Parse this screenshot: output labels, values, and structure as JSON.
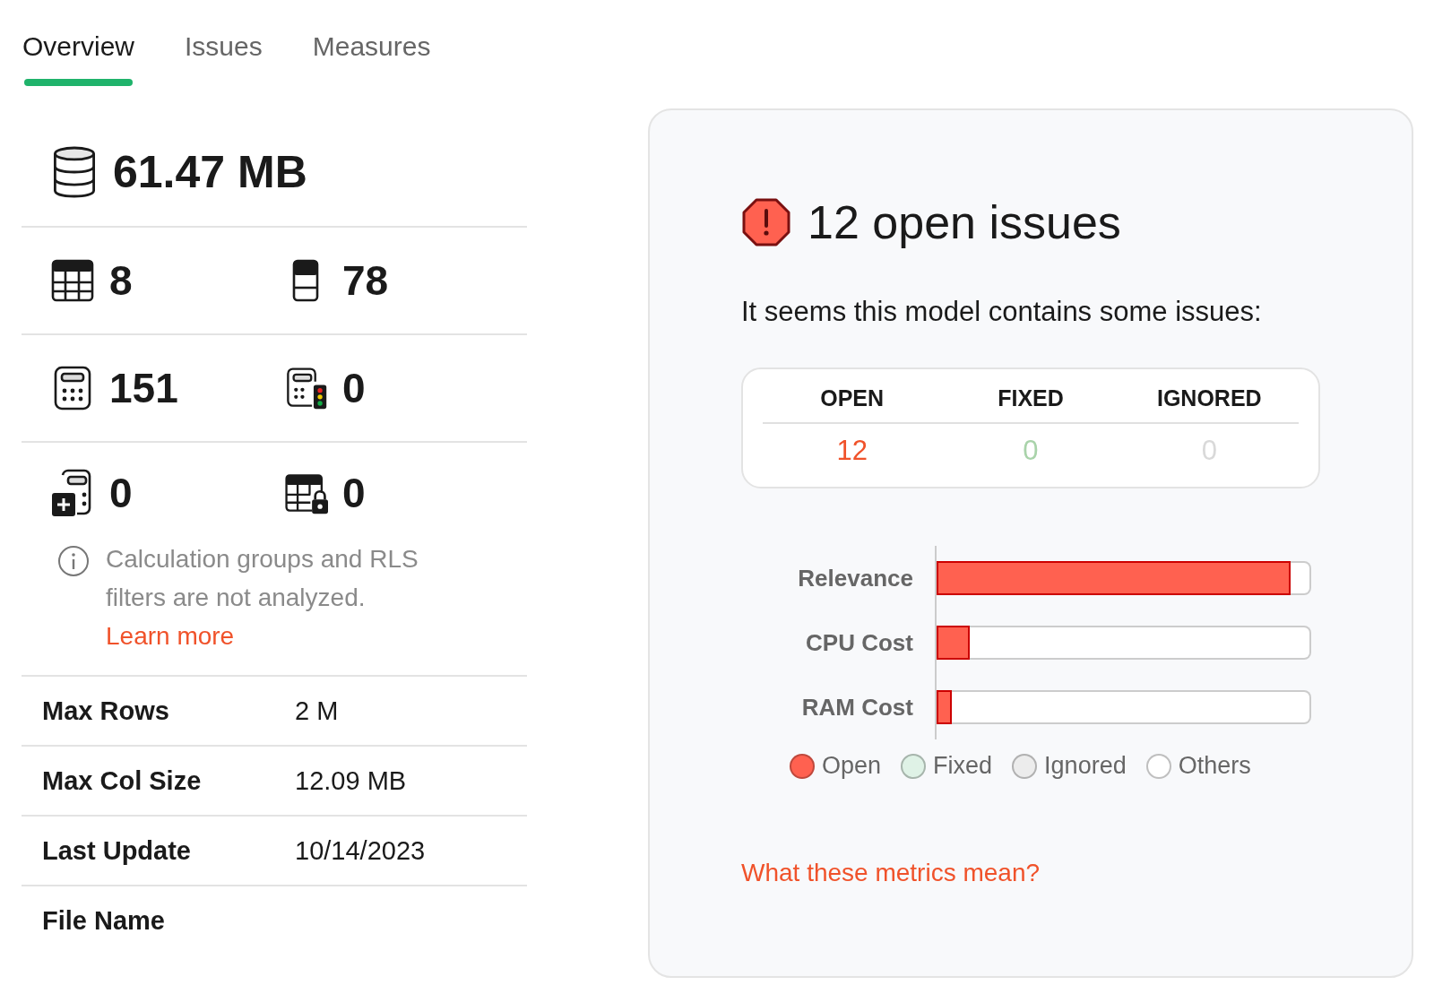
{
  "tabs": [
    {
      "label": "Overview",
      "selected": true
    },
    {
      "label": "Issues",
      "selected": false
    },
    {
      "label": "Measures",
      "selected": false
    }
  ],
  "stats": [
    [
      {
        "kind": "size",
        "value": "61.47 MB"
      }
    ],
    [
      {
        "kind": "table",
        "value": "8"
      },
      {
        "kind": "column",
        "value": "78"
      }
    ],
    [
      {
        "kind": "measure",
        "value": "151"
      },
      {
        "kind": "measure-check",
        "value": "0"
      }
    ],
    [
      {
        "kind": "calc-item",
        "value": "0"
      },
      {
        "kind": "rls",
        "value": "0"
      }
    ]
  ],
  "note": {
    "text": "Calculation groups and RLS filters are not analyzed.",
    "link": "Learn more"
  },
  "properties": [
    {
      "label": "Max Rows",
      "value": "2 M"
    },
    {
      "label": "Max Col Size",
      "value": "12.09 MB"
    },
    {
      "label": "Last Update",
      "value": "10/14/2023"
    },
    {
      "label": "File Name"
    }
  ],
  "issues": {
    "title": "12 open issues",
    "subtitle": "It seems this model contains some issues:",
    "summary": [
      {
        "label": "OPEN",
        "value": "12",
        "color": "#f0522a"
      },
      {
        "label": "FIXED",
        "value": "0",
        "color": "#a9d3aa"
      },
      {
        "label": "IGNORED",
        "value": "0",
        "color": "#d9d9d9"
      }
    ],
    "bars": [
      {
        "label": "Relevance",
        "level": 0.95
      },
      {
        "label": "CPU Cost",
        "level": 0.09
      },
      {
        "label": "RAM Cost",
        "level": 0.04
      }
    ],
    "legend": [
      {
        "label": "Open",
        "color": "#ff6150"
      },
      {
        "label": "Fixed",
        "color": "#dff2e6"
      },
      {
        "label": "Ignored",
        "color": "#ececec"
      },
      {
        "label": "Others",
        "color": "#ffffff"
      }
    ],
    "link": "What these metrics mean?"
  }
}
